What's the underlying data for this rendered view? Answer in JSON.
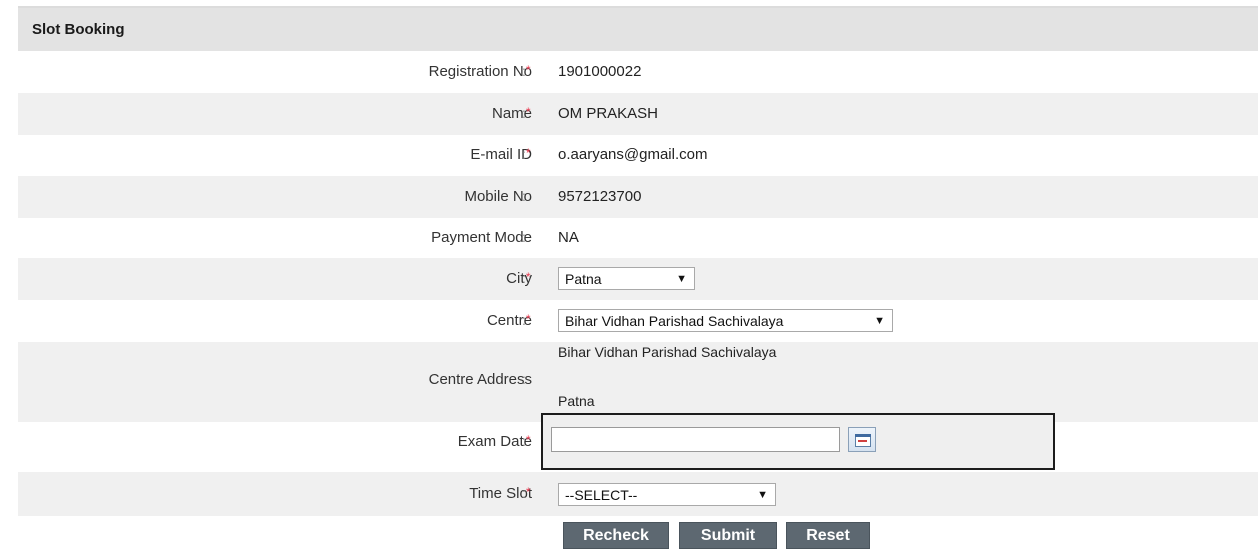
{
  "header": {
    "title": "Slot Booking"
  },
  "fields": {
    "registration": {
      "label": "Registration No",
      "colon": ":",
      "required": "*",
      "value": "1901000022"
    },
    "name": {
      "label": "Name",
      "colon": ":",
      "required": "*",
      "value": "OM PRAKASH"
    },
    "email": {
      "label": "E-mail ID",
      "colon": ":",
      "required": "*",
      "value": "o.aaryans@gmail.com"
    },
    "mobile": {
      "label": "Mobile No",
      "colon": ":",
      "value": "9572123700"
    },
    "payment": {
      "label": "Payment Mode",
      "colon": ":",
      "value": "NA"
    },
    "city": {
      "label": "City",
      "colon": ":",
      "required": "*",
      "selected": "Patna",
      "arrow": "▼"
    },
    "centre": {
      "label": "Centre",
      "colon": ":",
      "required": "*",
      "selected": "Bihar Vidhan Parishad Sachivalaya",
      "arrow": "▼"
    },
    "centre_address": {
      "label": "Centre Address",
      "colon": ":",
      "line1": "Bihar Vidhan Parishad Sachivalaya",
      "line2": "Patna"
    },
    "exam_date": {
      "label": "Exam Date",
      "colon": ":",
      "required": "*",
      "value": "",
      "icon": "calendar-icon"
    },
    "time_slot": {
      "label": "Time Slot",
      "colon": ":",
      "required": "*",
      "selected": "--SELECT--",
      "arrow": "▼"
    }
  },
  "buttons": {
    "recheck": "Recheck",
    "submit": "Submit",
    "reset": "Reset"
  },
  "colors": {
    "header_bg": "#e3e3e3",
    "alt_row_bg": "#f0f0f0",
    "required_star": "#e8384f",
    "button_bg": "#5d6871"
  }
}
